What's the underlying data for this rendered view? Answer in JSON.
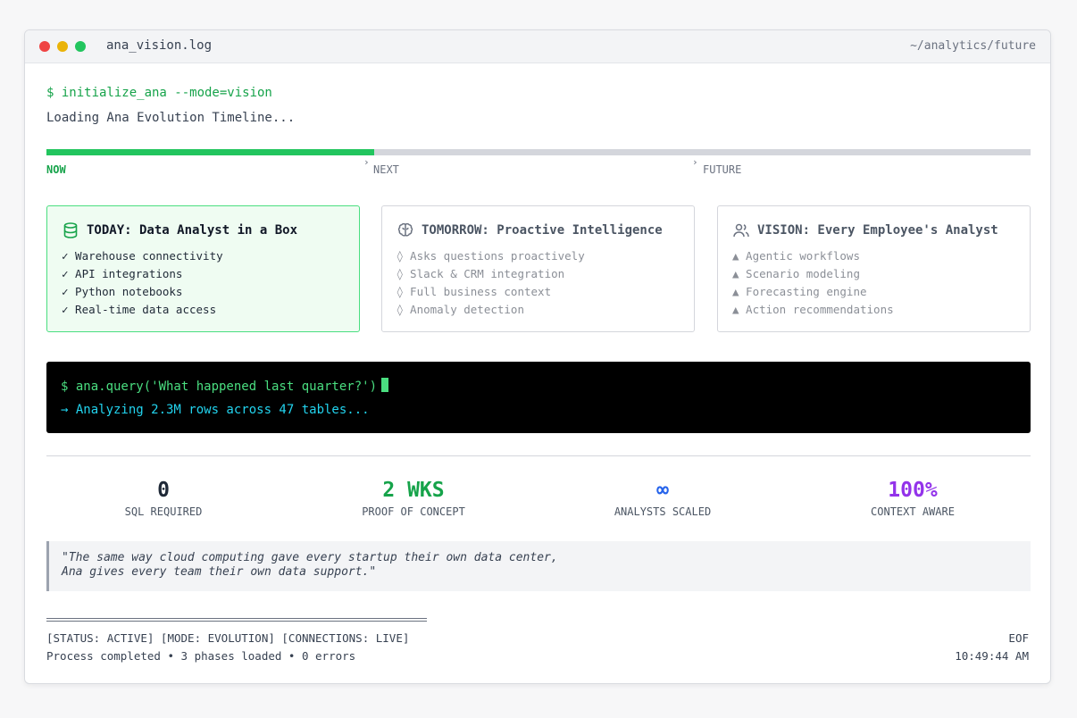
{
  "window": {
    "title": "ana_vision.log",
    "path": "~/analytics/future"
  },
  "console": {
    "command": "$ initialize_ana --mode=vision",
    "loading": "Loading Ana Evolution Timeline..."
  },
  "timeline": {
    "progress_fraction": 0.333,
    "phases": [
      {
        "label": "NOW",
        "active": true
      },
      {
        "label": "NEXT",
        "active": false
      },
      {
        "label": "FUTURE",
        "active": false
      }
    ],
    "chevron": "›"
  },
  "cards": [
    {
      "icon": "database-icon",
      "title": "TODAY: Data Analyst in a Box",
      "items": [
        "✓ Warehouse connectivity",
        "✓ API integrations",
        "✓ Python notebooks",
        "✓ Real-time data access"
      ]
    },
    {
      "icon": "brain-icon",
      "title": "TOMORROW: Proactive Intelligence",
      "items": [
        "◊ Asks questions proactively",
        "◊ Slack & CRM integration",
        "◊ Full business context",
        "◊ Anomaly detection"
      ]
    },
    {
      "icon": "users-icon",
      "title": "VISION: Every Employee's Analyst",
      "items": [
        "▲ Agentic workflows",
        "▲ Scenario modeling",
        "▲ Forecasting engine",
        "▲ Action recommendations"
      ]
    }
  ],
  "terminal": {
    "query": "$ ana.query('What happened last quarter?')",
    "output": "→ Analyzing 2.3M rows across 47 tables..."
  },
  "stats": [
    {
      "value": "0",
      "label": "SQL REQUIRED",
      "color": "#1f2937"
    },
    {
      "value": "2 WKS",
      "label": "PROOF OF CONCEPT",
      "color": "#16a34a"
    },
    {
      "value": "∞",
      "label": "ANALYSTS SCALED",
      "color": "#2563eb"
    },
    {
      "value": "100%",
      "label": "CONTEXT AWARE",
      "color": "#9333ea"
    }
  ],
  "quote": {
    "line1": "\"The same way cloud computing gave every startup their own data center,",
    "line2": "Ana gives every team their own data support.\""
  },
  "footer": {
    "status": "[STATUS: ACTIVE] [MODE: EVOLUTION] [CONNECTIONS: LIVE]",
    "summary": "Process completed • 3 phases loaded • 0 errors",
    "eof": "EOF",
    "time": "10:49:44 AM"
  },
  "colors": {
    "accent_green": "#22c55e",
    "terminal_green": "#4ade80",
    "terminal_cyan": "#22d3ee"
  }
}
